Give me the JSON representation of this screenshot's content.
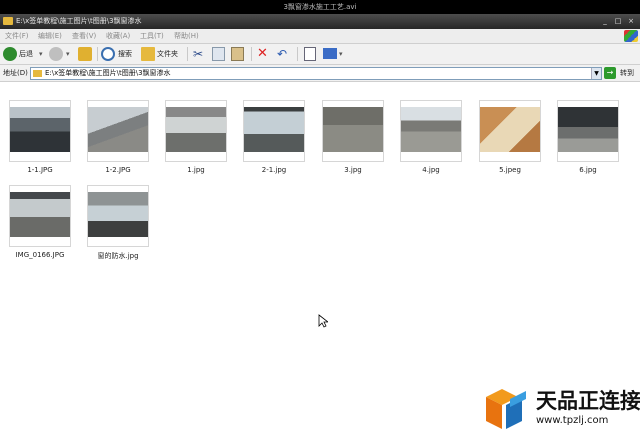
{
  "video_title": "3飘窗渗水施工工艺.avi",
  "window": {
    "title": "E:\\x签单教程\\施工图片\\t图册\\3飘窗渗水",
    "min_label": "_",
    "max_label": "□",
    "close_label": "×"
  },
  "menu": [
    "文件(F)",
    "编辑(E)",
    "查看(V)",
    "收藏(A)",
    "工具(T)",
    "帮助(H)"
  ],
  "toolbar": {
    "back_label": "后退",
    "search_label": "搜索",
    "folders_label": "文件夹"
  },
  "address": {
    "label": "地址(D)",
    "value": "E:\\x签单教程\\施工图片\\t图册\\3飘窗渗水",
    "go_label": "转到"
  },
  "files": [
    {
      "name": "1-1.JPG"
    },
    {
      "name": "1-2.JPG"
    },
    {
      "name": "1.jpg"
    },
    {
      "name": "2-1.jpg"
    },
    {
      "name": "3.jpg"
    },
    {
      "name": "4.jpg"
    },
    {
      "name": "5.jpeg"
    },
    {
      "name": "6.jpg"
    },
    {
      "name": "IMG_0166.JPG"
    },
    {
      "name": "窗的防水.jpg"
    }
  ],
  "watermark": {
    "text_cn": "天品正连接",
    "url": "www.tpzlj.com"
  }
}
